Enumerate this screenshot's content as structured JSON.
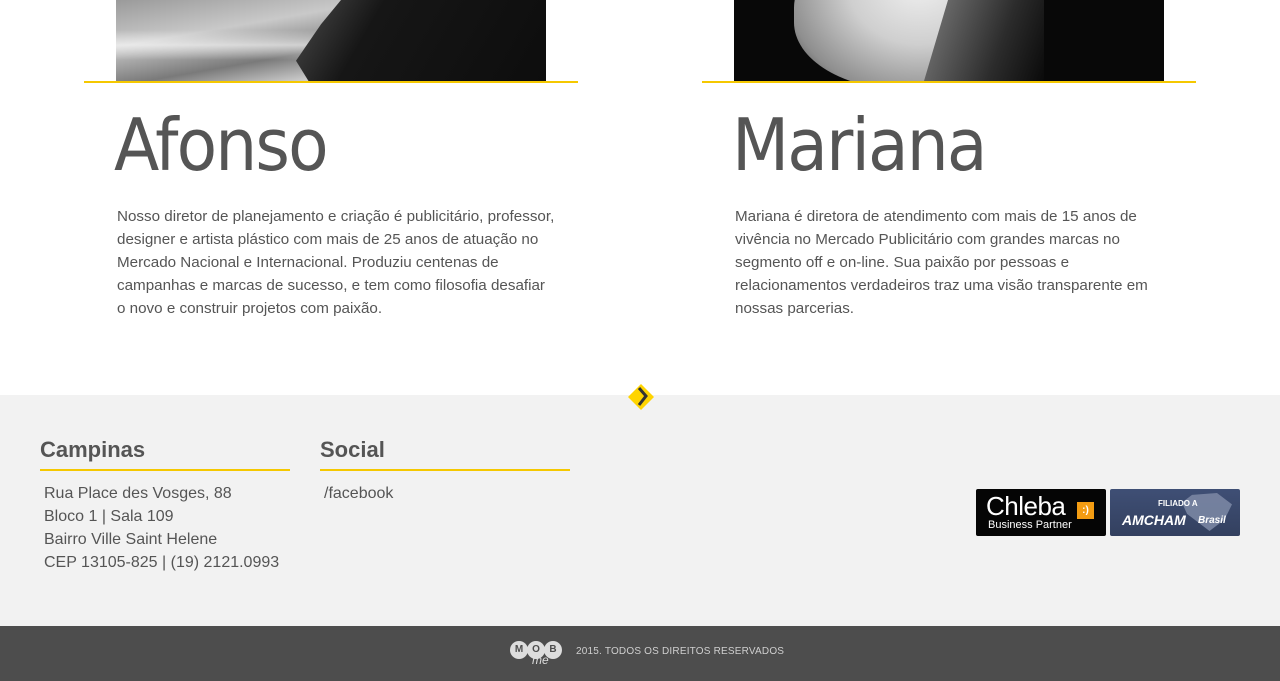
{
  "team": [
    {
      "name": "Afonso",
      "bio": "Nosso diretor de planejamento e criação é publicitário, professor, designer e artista plástico com mais de 25 anos de atuação no Mercado Nacional e Internacional. Produziu centenas de campanhas e marcas de sucesso, e tem como filosofia desafiar o novo e construir projetos com paixão."
    },
    {
      "name": "Mariana",
      "bio": "Mariana é diretora de atendimento com mais de 15 anos de vivência no Mercado Publicitário com grandes marcas no segmento off e on-line. Sua paixão por pessoas e relacionamentos verdadeiros traz uma visão transparente em nossas parcerias."
    }
  ],
  "footer": {
    "campinas": {
      "title": "Campinas",
      "lines": [
        "Rua Place des Vosges, 88",
        "Bloco 1 | Sala 109",
        "Bairro Ville Saint Helene",
        "CEP 13105-825 | (19) 2121.0993"
      ]
    },
    "social": {
      "title": "Social",
      "links": [
        "/facebook"
      ]
    },
    "badges": {
      "chleba": {
        "name": "Chleba",
        "smile": ":)",
        "subtitle": "Business Partner"
      },
      "amcham": {
        "top": "FILIADO A",
        "name": "AMCHAM",
        "country": "Brasil"
      }
    },
    "logo": {
      "letters": [
        "M",
        "O",
        "B"
      ],
      "suffix": "me"
    },
    "copyright": "2015. TODOS OS DIREITOS RESERVADOS"
  },
  "colors": {
    "accent": "#f5c800",
    "footer_bg": "#f2f2f2",
    "bottom_bar": "#4d4d4d",
    "text": "#555555"
  },
  "icons": {
    "scroll": "chevron-right-icon"
  }
}
